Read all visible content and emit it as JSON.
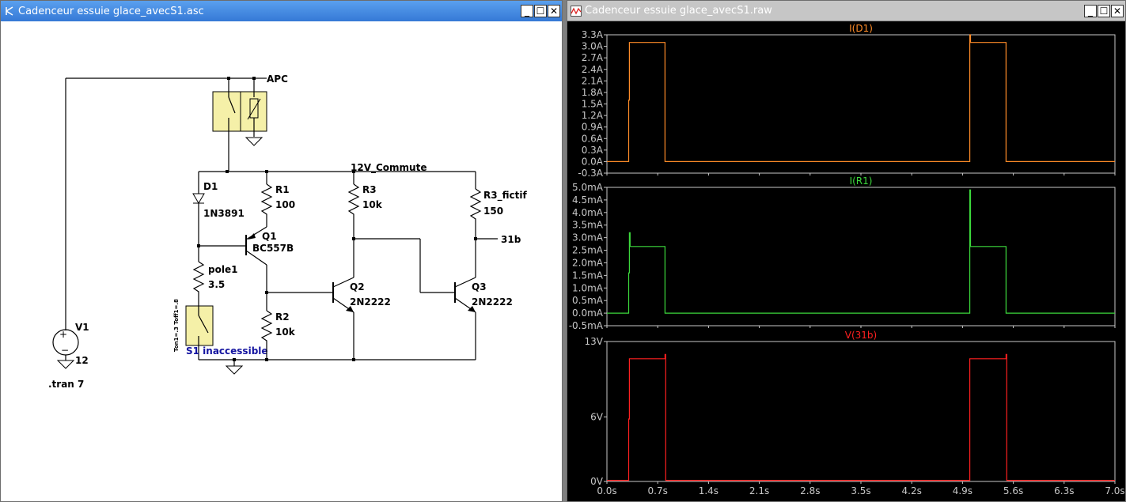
{
  "left_window": {
    "title": "Cadenceur essuie glace_avecS1.asc",
    "buttons": [
      "_",
      "☐",
      "✕"
    ]
  },
  "schematic": {
    "labels": {
      "apc": "APC",
      "net_12v": "12V_Commute",
      "d1": "D1",
      "d1_model": "1N3891",
      "r1": "R1",
      "r1_val": "100",
      "q1": "Q1",
      "q1_model": "BC557B",
      "pole1": "pole1",
      "pole1_val": "3.5",
      "s1": "S1 inaccessible",
      "s1_params": "Ton1=.3 Toff1=.8",
      "r2": "R2",
      "r2_val": "10k",
      "r3": "R3",
      "r3_val": "10k",
      "q2": "Q2",
      "q2_model": "2N2222",
      "r3f": "R3_fictif",
      "r3f_val": "150",
      "net_31b": "31b",
      "q3": "Q3",
      "q3_model": "2N2222",
      "v1": "V1",
      "v1_val": "12",
      "tran": ".tran 7"
    }
  },
  "right_window": {
    "title": "Cadenceur essuie glace_avecS1.raw",
    "buttons": [
      "_",
      "☐",
      "✕"
    ]
  },
  "colors": {
    "id1": "#ff8c28",
    "ir1": "#3cd93c",
    "v31b": "#ff2020",
    "axis": "#c8c8c8"
  },
  "chart_data": [
    {
      "type": "line",
      "title": "I(D1)",
      "ylim": [
        -0.3,
        3.3
      ],
      "y_ticks": [
        "3.3A",
        "3.0A",
        "2.7A",
        "2.4A",
        "2.1A",
        "1.8A",
        "1.5A",
        "1.2A",
        "0.9A",
        "0.6A",
        "0.3A",
        "0.0A",
        "-0.3A"
      ],
      "y_tick_values": [
        3.3,
        3.0,
        2.7,
        2.4,
        2.1,
        1.8,
        1.5,
        1.2,
        0.9,
        0.6,
        0.3,
        0.0,
        -0.3
      ],
      "series": [
        {
          "name": "I(D1)",
          "x": [
            0,
            0.3,
            0.3,
            0.31,
            0.31,
            0.8,
            0.8,
            5.0,
            5.0,
            5.01,
            5.01,
            5.5,
            5.5,
            7.0
          ],
          "y": [
            0,
            0,
            1.6,
            1.6,
            3.1,
            3.1,
            0,
            0,
            3.3,
            3.3,
            3.1,
            3.1,
            0,
            0
          ]
        }
      ]
    },
    {
      "type": "line",
      "title": "I(R1)",
      "ylim": [
        -0.5,
        5.0
      ],
      "y_ticks": [
        "5.0mA",
        "4.5mA",
        "4.0mA",
        "3.5mA",
        "3.0mA",
        "2.5mA",
        "2.0mA",
        "1.5mA",
        "1.0mA",
        "0.5mA",
        "0.0mA",
        "-0.5mA"
      ],
      "y_tick_values": [
        5.0,
        4.5,
        4.0,
        3.5,
        3.0,
        2.5,
        2.0,
        1.5,
        1.0,
        0.5,
        0.0,
        -0.5
      ],
      "series": [
        {
          "name": "I(R1)",
          "x": [
            0,
            0.3,
            0.3,
            0.31,
            0.31,
            0.32,
            0.32,
            0.8,
            0.8,
            5.0,
            5.0,
            5.01,
            5.01,
            5.5,
            5.5,
            7.0
          ],
          "y": [
            0,
            0,
            1.6,
            1.6,
            3.2,
            3.2,
            2.65,
            2.65,
            0,
            0,
            4.9,
            4.9,
            2.65,
            2.65,
            0,
            0
          ]
        }
      ]
    },
    {
      "type": "line",
      "title": "V(31b)",
      "ylim": [
        0,
        13
      ],
      "y_ticks": [
        "13V",
        "6V",
        "0V"
      ],
      "y_tick_values": [
        13,
        6,
        0
      ],
      "series": [
        {
          "name": "V(31b)",
          "x": [
            0,
            0.3,
            0.3,
            0.31,
            0.31,
            0.8,
            0.8,
            0.81,
            0.81,
            5.0,
            5.0,
            5.01,
            5.01,
            5.5,
            5.5,
            5.51,
            5.51,
            7.0
          ],
          "y": [
            0.1,
            0.1,
            5.8,
            5.8,
            11.4,
            11.4,
            11.8,
            11.8,
            0.1,
            0.1,
            11.4,
            11.4,
            11.4,
            11.4,
            11.8,
            11.8,
            0.1,
            0.1
          ]
        }
      ]
    }
  ],
  "x_axis": {
    "xlim": [
      0,
      7.0
    ],
    "ticks": [
      "0.0s",
      "0.7s",
      "1.4s",
      "2.1s",
      "2.8s",
      "3.5s",
      "4.2s",
      "4.9s",
      "5.6s",
      "6.3s",
      "7.0s"
    ],
    "tick_values": [
      0,
      0.7,
      1.4,
      2.1,
      2.8,
      3.5,
      4.2,
      4.9,
      5.6,
      6.3,
      7.0
    ]
  }
}
